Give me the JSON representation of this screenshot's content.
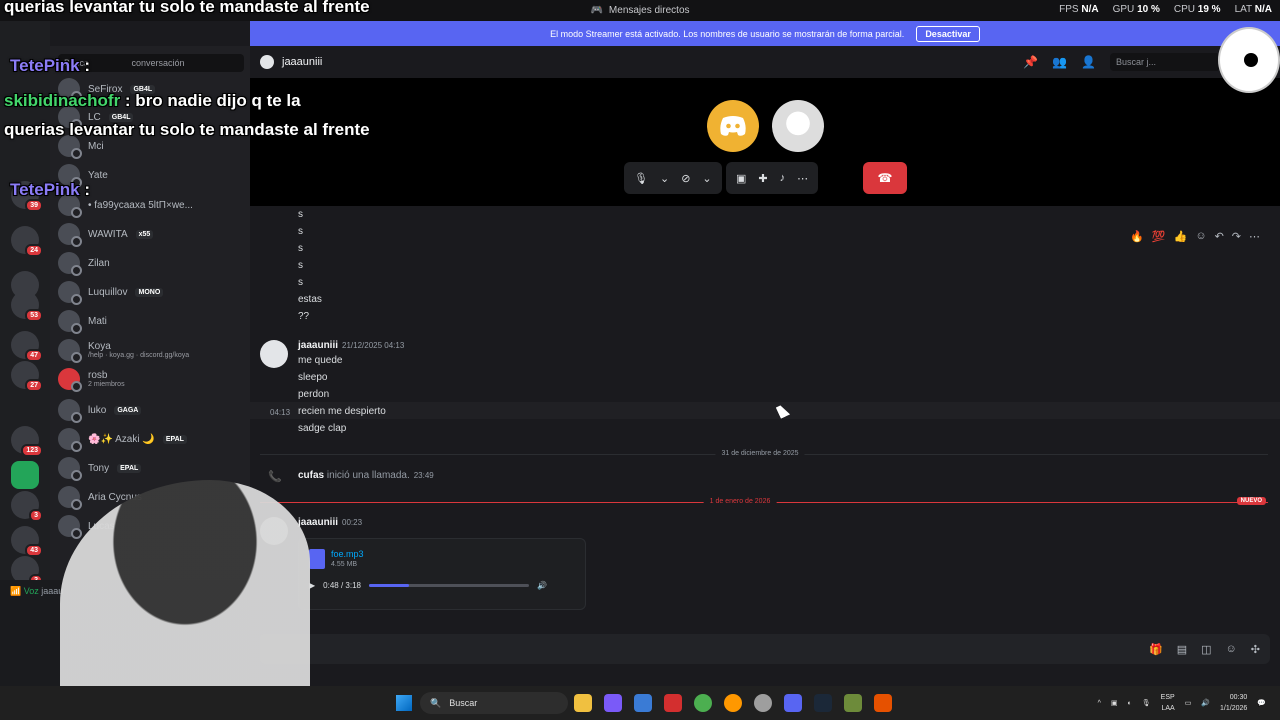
{
  "titlebar": {
    "title": "Mensajes directos",
    "fps_label": "FPS",
    "fps": "N/A",
    "gpu_label": "GPU",
    "gpu": "10 %",
    "cpu_label": "CPU",
    "cpu": "19 %",
    "lat_label": "LAT",
    "lat": "N/A"
  },
  "banner": {
    "text": "El modo Streamer está activado. Los nombres de usuario se mostrarán de forma parcial.",
    "button": "Desactivar"
  },
  "dm_search": {
    "placeholder": "Busca",
    "suffix": "conversación"
  },
  "dms": [
    {
      "name": "SeFirox",
      "tag": "GB4L"
    },
    {
      "name": "LC",
      "tag": "GB4L"
    },
    {
      "name": "Mci",
      "tag": ""
    },
    {
      "name": "Yate",
      "tag": ""
    },
    {
      "name": "• fa99ycaaxa 5ltΠ×we...",
      "tag": ""
    },
    {
      "name": "WAWITA",
      "tag": "x55"
    },
    {
      "name": "Zilan",
      "tag": ""
    },
    {
      "name": "Luquillov",
      "tag": "MONO"
    },
    {
      "name": "Mati",
      "tag": ""
    },
    {
      "name": "Koya",
      "tag": "",
      "sub": "/help · koya.gg · discord.gg/koya"
    },
    {
      "name": "rosb",
      "tag": "",
      "sub": "2 miembros"
    },
    {
      "name": "luko",
      "tag": "GAGA"
    },
    {
      "name": "🌸✨ Azaki 🌙",
      "tag": "EPAL"
    },
    {
      "name": "Tony",
      "tag": "EPAL"
    },
    {
      "name": "Aria Cycnus",
      "tag": ""
    },
    {
      "name": "Lucas",
      "tag": ""
    }
  ],
  "server_badges": [
    "39",
    "24",
    "53",
    "47",
    "27",
    "123",
    "3",
    "43",
    "3"
  ],
  "voice": {
    "label": "Voz",
    "user": "jaaau"
  },
  "chat": {
    "channel": "jaaauniii",
    "search_placeholder": "Buscar j...",
    "early_lines": [
      "s",
      "s",
      "s",
      "s",
      "s",
      "estas",
      "??"
    ],
    "group1": {
      "author": "jaaauniii",
      "time": "21/12/2025 04:13",
      "lines": [
        "me quede",
        "sleepo",
        "perdon",
        "recien me despierto",
        "sadge clap"
      ],
      "hover_time": "04:13"
    },
    "divider1": "31 de diciembre de 2025",
    "call": {
      "author": "cufas",
      "text": "inició una llamada.",
      "time": "23:49"
    },
    "divider2": "1 de enero de 2026",
    "nuevo": "NUEVO",
    "group2": {
      "author": "jaaauniii",
      "time": "00:23"
    },
    "attachment": {
      "filename": "foe.mp3",
      "size": "4.55 MB",
      "progress": "0:48 / 3:18",
      "played_fraction": 0.25
    }
  },
  "overlay": {
    "top_line": "querias levantar tu solo te mandaste al frente",
    "name1": "TetePink",
    "name2": "skibidinachofr",
    "msg2a": ": bro nadie dijo q te la",
    "msg2b": "querias levantar tu solo te mandaste al frente",
    "name3": "TetePink"
  },
  "taskbar": {
    "search": "Buscar",
    "lang1": "ESP",
    "lang2": "LAA",
    "time": "00:30",
    "date": "1/1/2026"
  },
  "colors": {
    "accent": "#5865f2",
    "danger": "#da373c",
    "online": "#23a559"
  }
}
